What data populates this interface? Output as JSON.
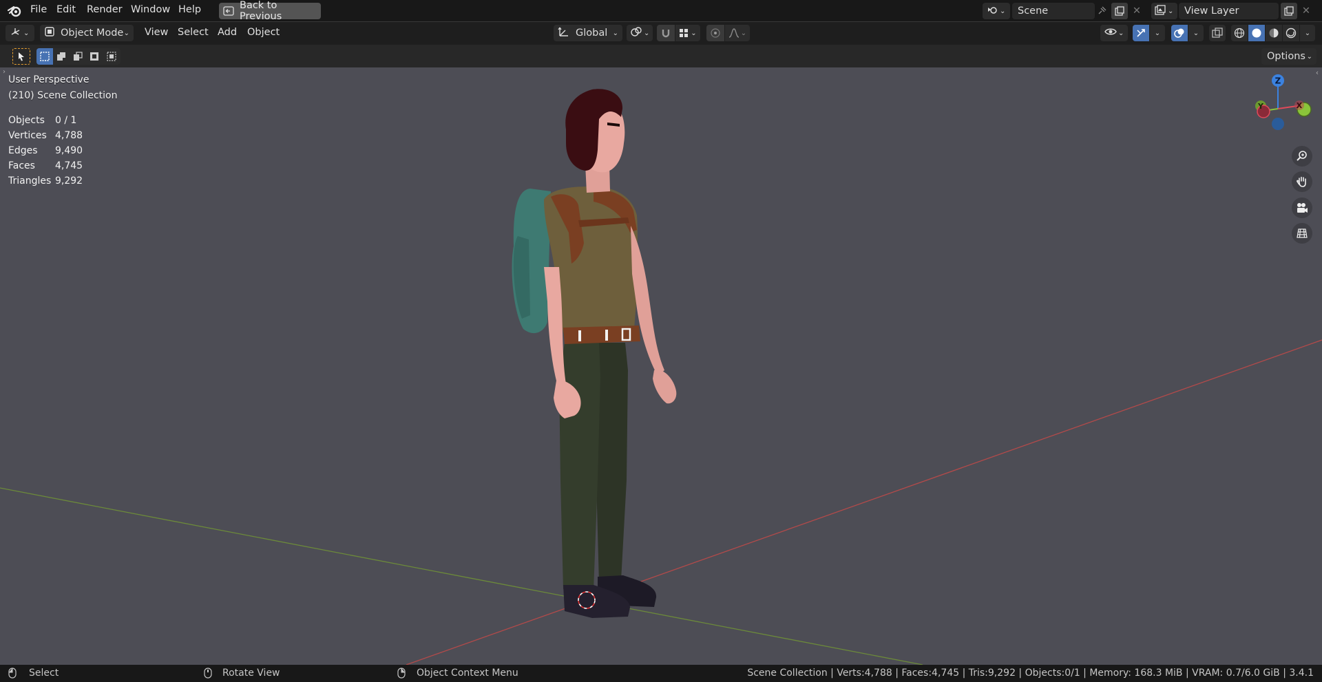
{
  "topbar": {
    "menus": [
      "File",
      "Edit",
      "Render",
      "Window",
      "Help"
    ],
    "back_button": "Back to Previous",
    "scene_name": "Scene",
    "view_layer_name": "View Layer"
  },
  "header": {
    "mode": "Object Mode",
    "menus": [
      "View",
      "Select",
      "Add",
      "Object"
    ],
    "orientation": "Global"
  },
  "toolbar": {
    "options_label": "Options"
  },
  "viewport": {
    "view_name": "User Perspective",
    "collection": "(210) Scene Collection",
    "stats": [
      {
        "label": "Objects",
        "value": "0 / 1"
      },
      {
        "label": "Vertices",
        "value": "4,788"
      },
      {
        "label": "Edges",
        "value": "9,490"
      },
      {
        "label": "Faces",
        "value": "4,745"
      },
      {
        "label": "Triangles",
        "value": "9,292"
      }
    ],
    "gizmo": {
      "z": "Z",
      "x": "X",
      "y": "Y"
    }
  },
  "statusbar": {
    "left_action": "Select",
    "middle_action": "Rotate View",
    "right_action": "Object Context Menu",
    "info": "Scene Collection | Verts:4,788 | Faces:4,745 | Tris:9,292 | Objects:0/1 | Memory: 168.3 MiB | VRAM: 0.7/6.0 GiB | 3.4.1"
  },
  "colors": {
    "axis_x": "#b34a4a",
    "axis_y": "#6c8a3a",
    "gizmo_x": "#e04a5a",
    "gizmo_y": "#8ac43a",
    "gizmo_z": "#3b82e0",
    "accent": "#4772b3"
  },
  "icons": [
    "blender-logo-icon",
    "back-icon",
    "scene-icon",
    "pin-icon",
    "new-scene-icon",
    "close-icon",
    "view-layer-icon",
    "editor-type-icon",
    "object-mode-icon",
    "orientation-icon",
    "pivot-icon",
    "snap-icon",
    "snap-grid-icon",
    "proportional-icon",
    "falloff-icon",
    "visibility-icon",
    "gizmo-icon",
    "overlay-icon",
    "xray-icon",
    "wireframe-icon",
    "solid-icon",
    "material-icon",
    "rendered-icon",
    "select-tool-icon",
    "zoom-icon",
    "hand-icon",
    "camera-icon",
    "grid-icon",
    "mouse-icon"
  ]
}
